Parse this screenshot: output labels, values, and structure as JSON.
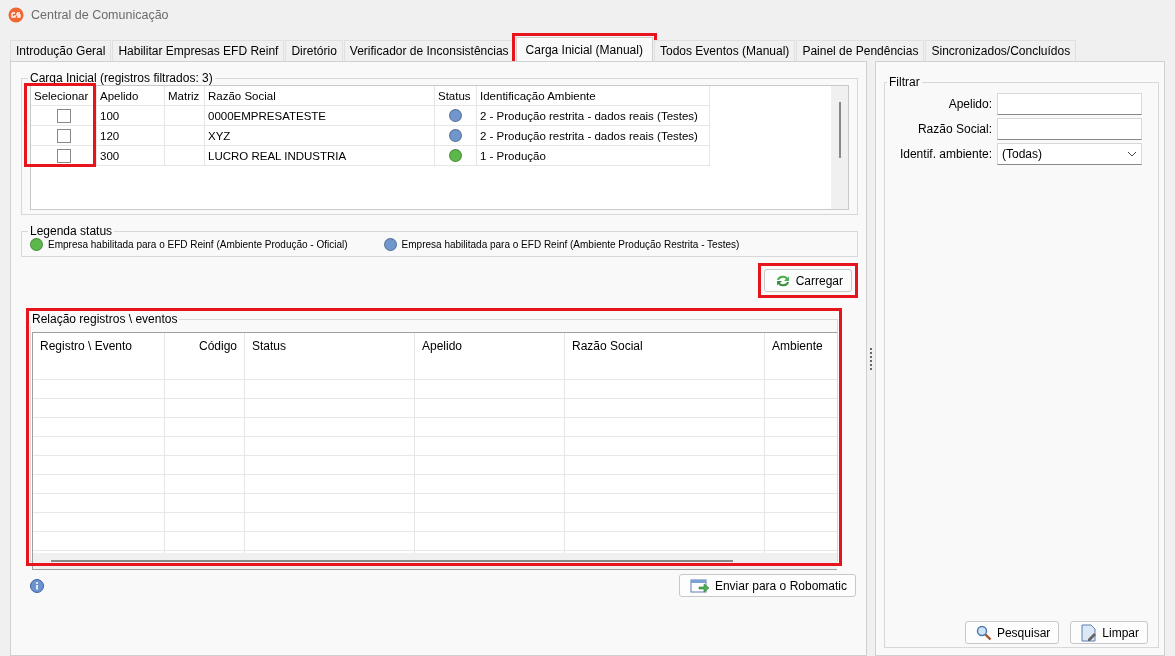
{
  "window": {
    "title": "Central de Comunicação"
  },
  "tabs": [
    {
      "label": "Introdução Geral",
      "selected": false,
      "highlighted": false
    },
    {
      "label": "Habilitar Empresas EFD Reinf",
      "selected": false,
      "highlighted": false
    },
    {
      "label": "Diretório",
      "selected": false,
      "highlighted": false
    },
    {
      "label": "Verificador de Inconsistências",
      "selected": false,
      "highlighted": false
    },
    {
      "label": "Carga Inicial (Manual)",
      "selected": true,
      "highlighted": true
    },
    {
      "label": "Todos Eventos (Manual)",
      "selected": false,
      "highlighted": false
    },
    {
      "label": "Painel de Pendências",
      "selected": false,
      "highlighted": false
    },
    {
      "label": "Sincronizados/Concluídos",
      "selected": false,
      "highlighted": false
    }
  ],
  "carga_inicial": {
    "title": "Carga Inicial (registros filtrados: 3)",
    "selecionar_column_highlighted": true,
    "columns": [
      "Selecionar",
      "Apelido",
      "Matriz",
      "Razão Social",
      "Status",
      "Identificação Ambiente"
    ],
    "rows": [
      {
        "checked": false,
        "apelido": "100",
        "razao_social": "0000EMPRESATESTE",
        "color": "#7196cc",
        "ambiente": "2 - Produção restrita - dados reais (Testes)"
      },
      {
        "checked": false,
        "apelido": "120",
        "razao_social": "XYZ",
        "color": "#7196cc",
        "ambiente": "2 - Produção restrita - dados reais (Testes)"
      },
      {
        "checked": false,
        "apelido": "300",
        "razao_social": "LUCRO REAL INDUSTRIA",
        "color": "#5cb84a",
        "ambiente": "1 - Produção"
      }
    ]
  },
  "legend": {
    "title": "Legenda status",
    "items": [
      {
        "color": "#5cb84a",
        "label": "Empresa habilitada para o EFD Reinf (Ambiente Produção - Oficial)"
      },
      {
        "color": "#7196cc",
        "label": "Empresa habilitada para o EFD Reinf (Ambiente Produção Restrita - Testes)"
      }
    ]
  },
  "carregar_button": {
    "label": "Carregar",
    "highlighted": true
  },
  "relacao": {
    "title": "Relação registros \\ eventos",
    "highlighted": true,
    "columns": [
      "Registro \\ Evento",
      "Código",
      "Status",
      "Apelido",
      "Razão Social",
      "Ambiente"
    ]
  },
  "send_button": {
    "label": "Enviar para o Robomatic"
  },
  "filter": {
    "title": "Filtrar",
    "fields": [
      {
        "kind": "text",
        "label": "Apelido:"
      },
      {
        "kind": "text",
        "label": "Razão Social:"
      },
      {
        "kind": "select",
        "label": "Identif. ambiente:",
        "value": "(Todas)"
      }
    ],
    "buttons": [
      {
        "kind": "search",
        "label": "Pesquisar"
      },
      {
        "kind": "clear",
        "label": "Limpar"
      }
    ]
  }
}
